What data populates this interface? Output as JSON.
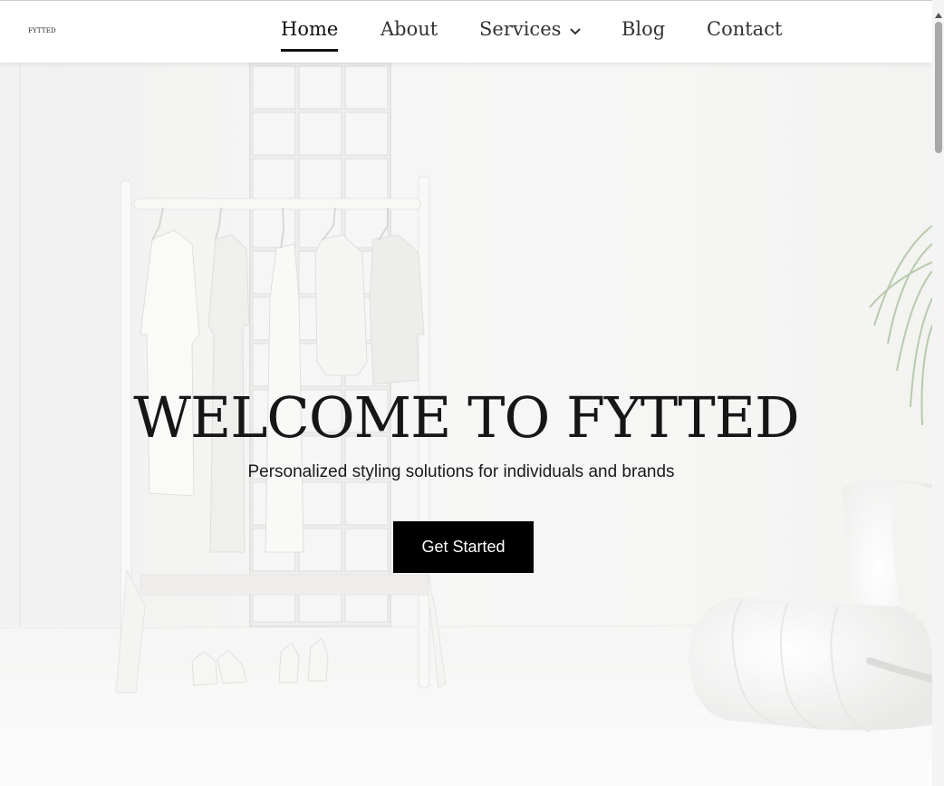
{
  "brand": {
    "logo_text": "FYTTED"
  },
  "nav": {
    "items": [
      {
        "label": "Home",
        "active": true
      },
      {
        "label": "About"
      },
      {
        "label": "Services",
        "has_dropdown": true
      },
      {
        "label": "Blog"
      },
      {
        "label": "Contact"
      }
    ]
  },
  "hero": {
    "title": "WELCOME TO FYTTED",
    "subtitle": "Personalized styling solutions for individuals and brands",
    "cta_label": "Get Started",
    "background_image": "white minimalist room with clothing rack, glass block column, shoes, chair and plant"
  },
  "colors": {
    "accent": "#000000",
    "nav_text": "#333333",
    "hero_background": "#f3f3f2"
  }
}
